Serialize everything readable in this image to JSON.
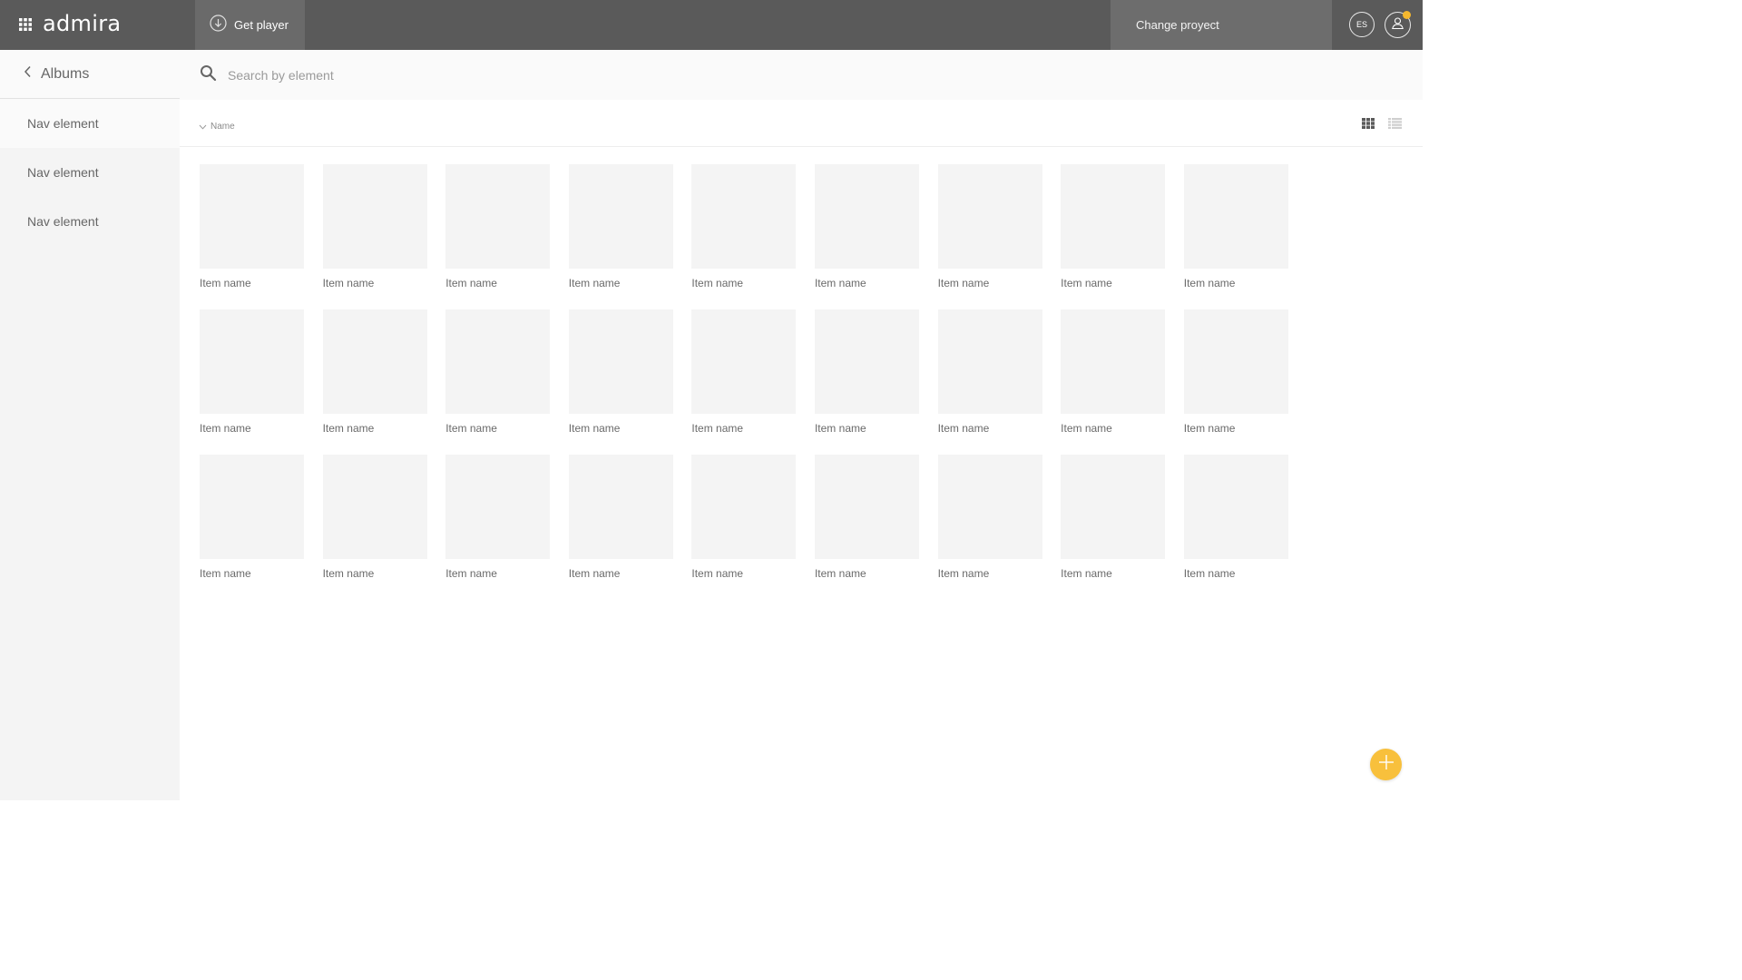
{
  "topbar": {
    "apps_icon": "apps-grid-icon",
    "logo": "admira",
    "get_player_label": "Get player",
    "get_player_icon": "download-circle-icon",
    "change_project_label": "Change proyect",
    "language": "ES",
    "user_icon": "user-icon",
    "notification_color": "#f5b82e"
  },
  "sidebar": {
    "back_label": "Albums",
    "items": [
      {
        "label": "Nav element"
      },
      {
        "label": "Nav element"
      },
      {
        "label": "Nav element"
      }
    ]
  },
  "search": {
    "placeholder": "Search by element"
  },
  "sort": {
    "label": "Name"
  },
  "items": [
    {
      "name": "Item name"
    },
    {
      "name": "Item name"
    },
    {
      "name": "Item name"
    },
    {
      "name": "Item name"
    },
    {
      "name": "Item name"
    },
    {
      "name": "Item name"
    },
    {
      "name": "Item name"
    },
    {
      "name": "Item name"
    },
    {
      "name": "Item name"
    },
    {
      "name": "Item name"
    },
    {
      "name": "Item name"
    },
    {
      "name": "Item name"
    },
    {
      "name": "Item name"
    },
    {
      "name": "Item name"
    },
    {
      "name": "Item name"
    },
    {
      "name": "Item name"
    },
    {
      "name": "Item name"
    },
    {
      "name": "Item name"
    },
    {
      "name": "Item name"
    },
    {
      "name": "Item name"
    },
    {
      "name": "Item name"
    },
    {
      "name": "Item name"
    },
    {
      "name": "Item name"
    },
    {
      "name": "Item name"
    },
    {
      "name": "Item name"
    },
    {
      "name": "Item name"
    },
    {
      "name": "Item name"
    }
  ],
  "colors": {
    "topbar": "#5a5a5a",
    "accent": "#f8c03c"
  }
}
